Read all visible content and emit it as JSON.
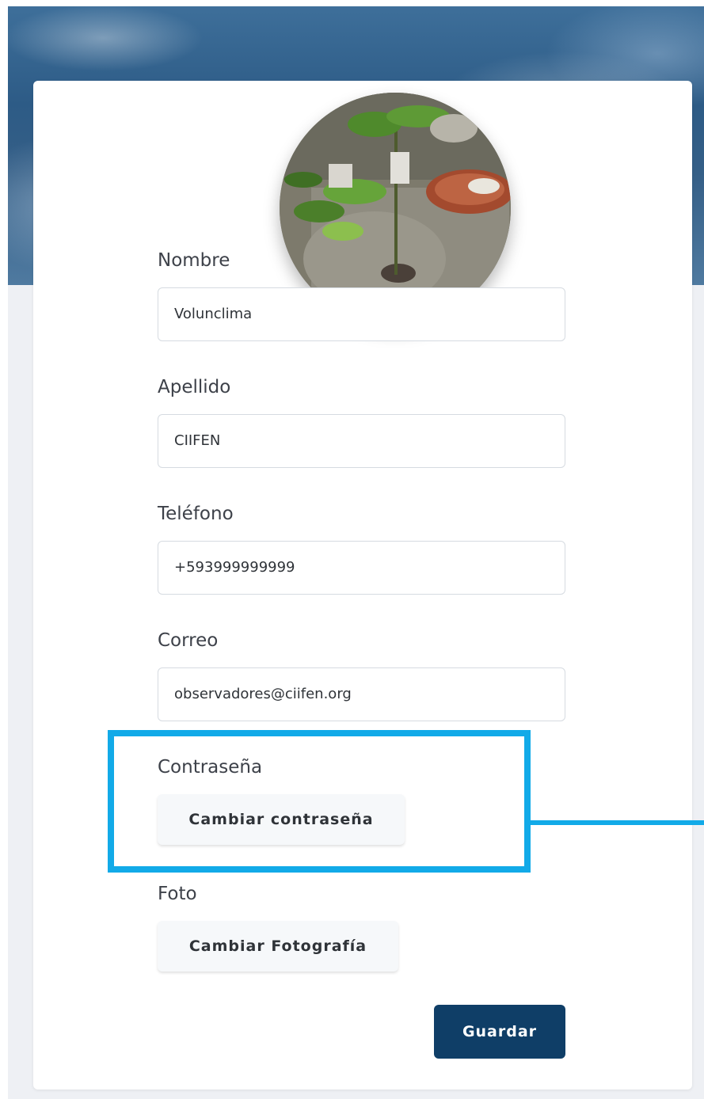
{
  "profile": {
    "avatar_alt": "Foto de perfil",
    "fields": [
      {
        "label": "Nombre",
        "value": "Volunclima"
      },
      {
        "label": "Apellido",
        "value": "CIIFEN"
      },
      {
        "label": "Teléfono",
        "value": "+593999999999"
      },
      {
        "label": "Correo",
        "value": "observadores@ciifen.org"
      }
    ],
    "password": {
      "label": "Contraseña",
      "button": "Cambiar contraseña"
    },
    "photo": {
      "label": "Foto",
      "button": "Cambiar Fotografía"
    },
    "save_button": "Guardar"
  },
  "colors": {
    "primary": "#0f3e67",
    "highlight": "#12aae8",
    "hero": "#2d5b86"
  }
}
